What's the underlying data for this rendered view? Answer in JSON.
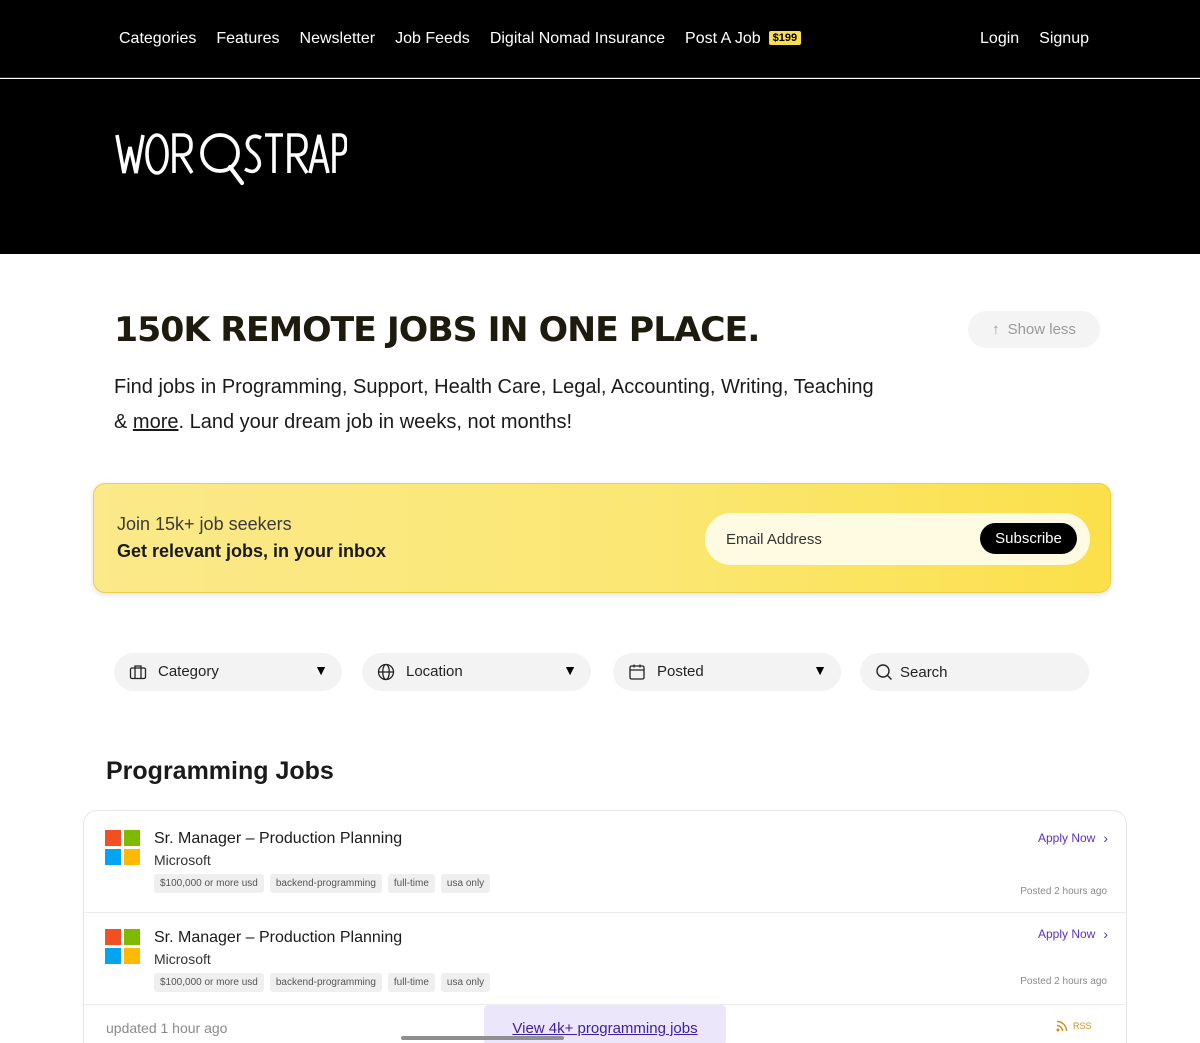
{
  "nav": {
    "links": [
      "Categories",
      "Features",
      "Newsletter",
      "Job Feeds",
      "Digital Nomad Insurance",
      "Post A Job"
    ],
    "post_price": "$199",
    "login": "Login",
    "signup": "Signup"
  },
  "logo": {
    "text": "WORKSTRAP"
  },
  "hero": {
    "headline": "150K REMOTE JOBS IN ONE PLACE.",
    "show_less": "Show less",
    "subtext_before": "Find jobs in Programming, Support, Health Care, Legal, Accounting, Writing, Teaching & ",
    "subtext_link": "more",
    "subtext_after": ". Land your dream job in weeks, not months!"
  },
  "newsletter": {
    "line1": "Join 15k+ job seekers",
    "line2": "Get relevant jobs, in your inbox",
    "email_placeholder": "Email Address",
    "button": "Subscribe"
  },
  "filters": {
    "category": "Category",
    "location": "Location",
    "posted": "Posted",
    "search_placeholder": "Search"
  },
  "jobs": {
    "section_title": "Programming Jobs",
    "items": [
      {
        "title": "Sr. Manager – Production Planning",
        "company": "Microsoft",
        "tags": [
          "$100,000 or more usd",
          "backend-programming",
          "full-time",
          "usa only"
        ],
        "apply": "Apply Now",
        "posted": "Posted 2 hours ago"
      },
      {
        "title": "Sr. Manager – Production Planning",
        "company": "Microsoft",
        "tags": [
          "$100,000 or more usd",
          "backend-programming",
          "full-time",
          "usa only"
        ],
        "apply": "Apply Now",
        "posted": "Posted 2 hours ago"
      }
    ],
    "updated": "updated 1 hour ago",
    "view_more": "View 4k+ programming jobs",
    "rss": "RSS"
  },
  "colors": {
    "accent_purple": "#5b2fc4",
    "badge_yellow": "#f9e04b",
    "newsletter_yellow": "#fbe773",
    "ms_red": "#f25022",
    "ms_green": "#7fba00",
    "ms_blue": "#00a4ef",
    "ms_yellow": "#ffb900"
  }
}
